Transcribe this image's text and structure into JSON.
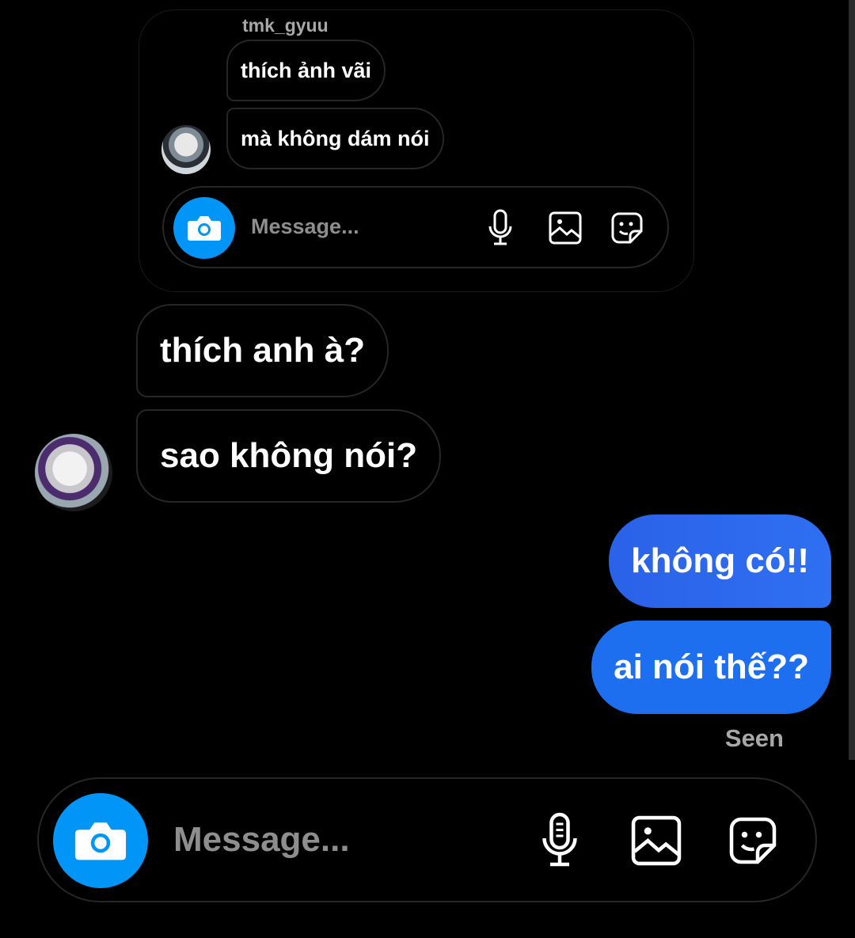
{
  "quoted": {
    "username": "tmk_gyuu",
    "messages": [
      "thích ảnh vãi",
      "mà không dám nói"
    ],
    "composer": {
      "placeholder": "Message..."
    }
  },
  "thread": {
    "received": [
      "thích anh à?",
      "sao không nói?"
    ],
    "sent": [
      "không có!!",
      "ai nói thế??"
    ],
    "status": "Seen"
  },
  "composer": {
    "placeholder": "Message...",
    "icons": [
      "camera-icon",
      "microphone-icon",
      "gallery-icon",
      "sticker-icon"
    ]
  },
  "colors": {
    "accent": "#0095f6",
    "sent_bubble": "#1f6ff0",
    "border": "#262626"
  }
}
